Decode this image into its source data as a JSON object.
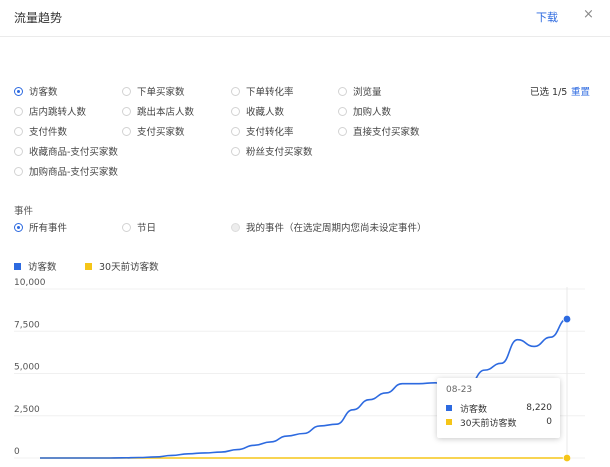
{
  "header": {
    "title": "流量趋势",
    "download_label": "下载",
    "close_icon": "×"
  },
  "metrics": {
    "selected_text": "已选 1/5",
    "reset_label": "重置",
    "items": [
      {
        "label": "访客数",
        "checked": true
      },
      {
        "label": "下单买家数",
        "checked": false
      },
      {
        "label": "下单转化率",
        "checked": false
      },
      {
        "label": "浏览量",
        "checked": false
      },
      {
        "label": "店内跳转人数",
        "checked": false
      },
      {
        "label": "跳出本店人数",
        "checked": false
      },
      {
        "label": "收藏人数",
        "checked": false
      },
      {
        "label": "加购人数",
        "checked": false
      },
      {
        "label": "支付件数",
        "checked": false
      },
      {
        "label": "支付买家数",
        "checked": false
      },
      {
        "label": "支付转化率",
        "checked": false
      },
      {
        "label": "直接支付买家数",
        "checked": false
      },
      {
        "label": "收藏商品-支付买家数",
        "checked": false
      },
      {
        "label": "粉丝支付买家数",
        "checked": false
      },
      {
        "label": "加购商品-支付买家数",
        "checked": false
      }
    ]
  },
  "events": {
    "section_label": "事件",
    "options": [
      {
        "label": "所有事件",
        "checked": true,
        "disabled": false
      },
      {
        "label": "节日",
        "checked": false,
        "disabled": false
      },
      {
        "label": "我的事件（在选定周期内您尚未设定事件）",
        "checked": false,
        "disabled": true
      }
    ]
  },
  "legend": [
    {
      "name": "访客数",
      "color": "#2d6ae0"
    },
    {
      "name": "30天前访客数",
      "color": "#f5c518"
    }
  ],
  "chart_data": {
    "type": "line",
    "ylim": [
      0,
      10000
    ],
    "y_ticks": [
      0,
      2500,
      5000,
      7500,
      10000
    ],
    "y_tick_labels": [
      "0",
      "2,500",
      "5,000",
      "7,500",
      "10,000"
    ],
    "grid": true,
    "series": [
      {
        "name": "访客数",
        "color": "#2d6ae0",
        "values": [
          0,
          0,
          0,
          0,
          0,
          10,
          30,
          60,
          150,
          250,
          300,
          350,
          500,
          750,
          950,
          1300,
          1450,
          1900,
          2000,
          2850,
          3450,
          3850,
          4400,
          4400,
          4450,
          4300,
          4300,
          5200,
          5600,
          7000,
          6600,
          7150,
          8220
        ]
      },
      {
        "name": "30天前访客数",
        "color": "#f5c518",
        "values": [
          0,
          0,
          0,
          0,
          0,
          0,
          0,
          0,
          0,
          0,
          0,
          0,
          0,
          0,
          0,
          0,
          0,
          0,
          0,
          0,
          0,
          0,
          0,
          0,
          0,
          0,
          0,
          0,
          0,
          0,
          0,
          0,
          0
        ]
      }
    ]
  },
  "tooltip": {
    "date": "08-23",
    "rows": [
      {
        "name": "访客数",
        "value": "8,220",
        "color": "#2d6ae0"
      },
      {
        "name": "30天前访客数",
        "value": "0",
        "color": "#f5c518"
      }
    ]
  }
}
